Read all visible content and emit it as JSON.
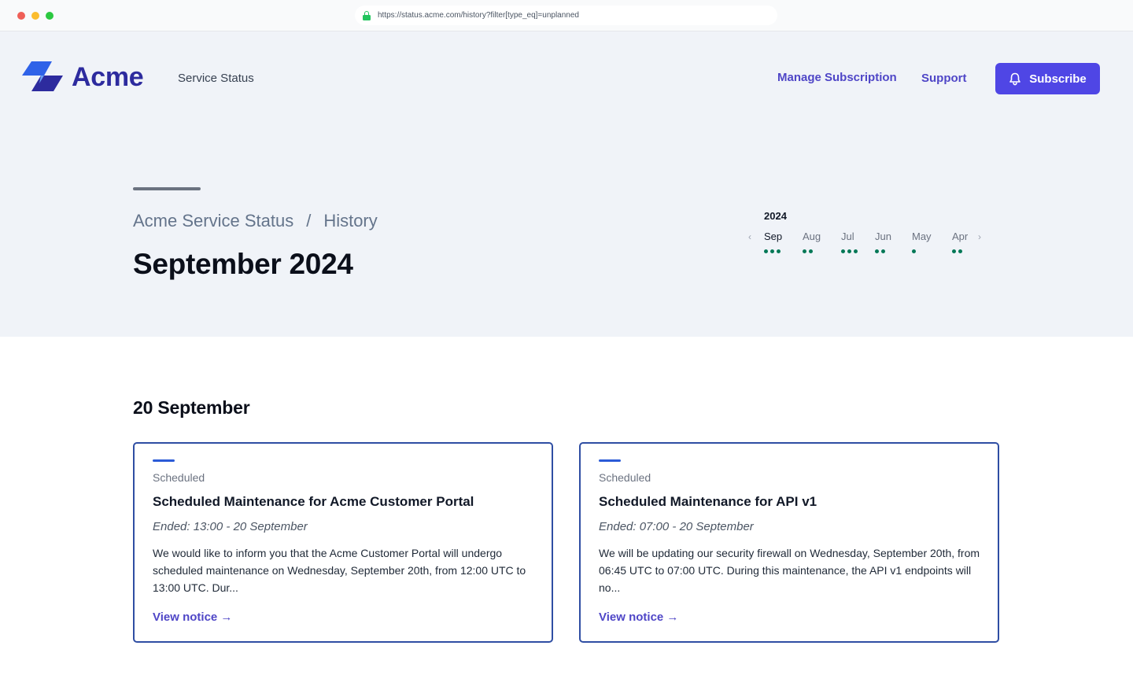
{
  "browser": {
    "url": "https://status.acme.com/history?filter[type_eq]=unplanned"
  },
  "header": {
    "brand": "Acme",
    "subtitle": "Service Status",
    "nav": {
      "manage": "Manage Subscription",
      "support": "Support"
    },
    "subscribe_label": "Subscribe"
  },
  "breadcrumb": {
    "root": "Acme Service Status",
    "separator": "/",
    "current": "History"
  },
  "page_title": "September 2024",
  "month_picker": {
    "year": "2024",
    "months": [
      {
        "label": "Sep",
        "dots": 3,
        "active": true
      },
      {
        "label": "Aug",
        "dots": 2,
        "active": false
      },
      {
        "label": "Jul",
        "dots": 3,
        "active": false
      },
      {
        "label": "Jun",
        "dots": 2,
        "active": false
      },
      {
        "label": "May",
        "dots": 1,
        "active": false
      },
      {
        "label": "Apr",
        "dots": 2,
        "active": false
      }
    ],
    "prev_icon": "chevron-left-icon",
    "next_icon": "chevron-right-icon"
  },
  "day_heading": "20 September",
  "cards": [
    {
      "type": "Scheduled",
      "title": "Scheduled Maintenance for Acme Customer Portal",
      "ended": "Ended: 13:00 - 20 September",
      "description": "We would like to inform you that the Acme Customer Portal will undergo scheduled maintenance on Wednesday, September 20th, from 12:00 UTC to 13:00 UTC. Dur...",
      "link": "View notice →"
    },
    {
      "type": "Scheduled",
      "title": "Scheduled Maintenance for API v1",
      "ended": "Ended: 07:00 - 20 September",
      "description": "We will be updating our security firewall on Wednesday, September 20th, from 06:45 UTC to 07:00 UTC. During this maintenance, the API v1 endpoints will no...",
      "link": "View notice →"
    }
  ],
  "colors": {
    "brand": "#2d2b9e",
    "accent": "#4f46e5",
    "status_green": "#047857",
    "card_border": "#2f4ea3"
  }
}
